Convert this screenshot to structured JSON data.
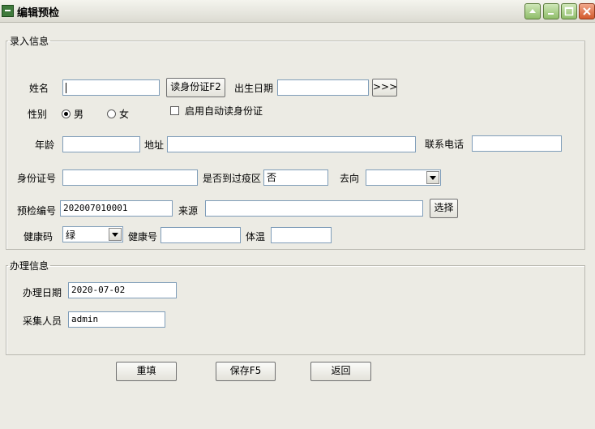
{
  "window": {
    "title": "编辑预检",
    "buttons": [
      "minimize",
      "maximize",
      "close"
    ]
  },
  "entry_group": {
    "legend": "录入信息",
    "name_label": "姓名",
    "name_value": "",
    "read_id_button": "读身份证F2",
    "birth_label": "出生日期",
    "birth_value": "",
    "more_button": ">>>",
    "gender_label": "性别",
    "gender_options": [
      "男",
      "女"
    ],
    "gender_selected": "男",
    "auto_read_label": "启用自动读身份证",
    "auto_read_checked": false,
    "age_label": "年龄",
    "age_value": "",
    "address_label": "地址",
    "address_value": "",
    "phone_label": "联系电话",
    "phone_value": "",
    "id_label": "身份证号",
    "id_value": "",
    "epidemic_label": "是否到过疫区",
    "epidemic_value": "否",
    "destination_label": "去向",
    "destination_value": "",
    "precheck_no_label": "预检编号",
    "precheck_no_value": "202007010001",
    "source_label": "来源",
    "source_value": "",
    "select_button": "选择",
    "health_code_label": "健康码",
    "health_code_value": "绿",
    "health_no_label": "健康号",
    "health_no_value": "",
    "temperature_label": "体温",
    "temperature_value": ""
  },
  "handle_group": {
    "legend": "办理信息",
    "date_label": "办理日期",
    "date_value": "2020-07-02",
    "collector_label": "采集人员",
    "collector_value": "admin"
  },
  "actions": {
    "reset": "重填",
    "save": "保存F5",
    "back": "返回"
  },
  "colors": {
    "window_bg": "#ecebe4",
    "input_border": "#7f9db9",
    "close_button": "#d35a2c",
    "control_button": "#8fbd6a"
  }
}
